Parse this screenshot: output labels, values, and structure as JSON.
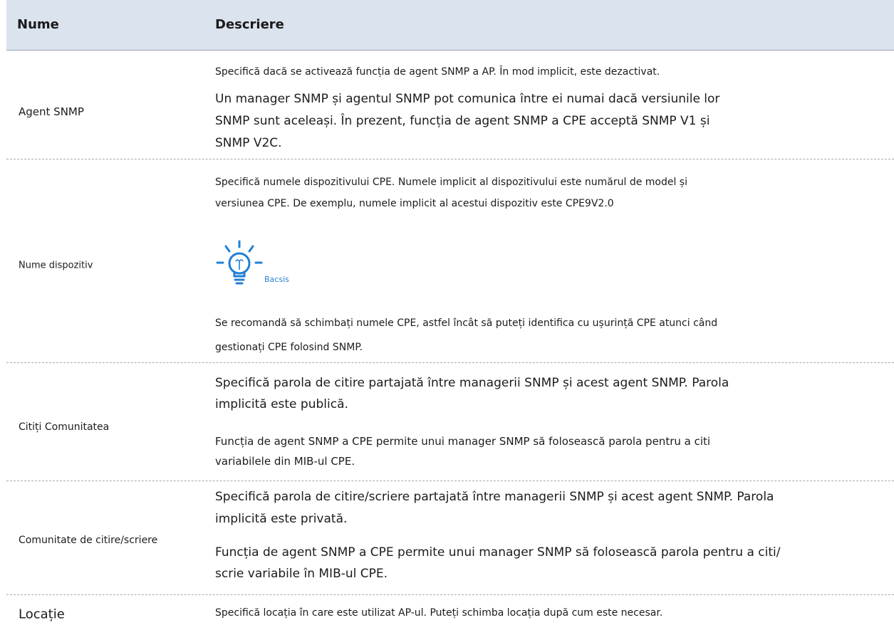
{
  "table": {
    "headers": {
      "name": "Nume",
      "description": "Descriere"
    },
    "rows": [
      {
        "name": "Agent SNMP",
        "lines": [
          "Specifică dacă se activează funcția de agent SNMP a AP. În mod implicit, este dezactivat.",
          "Un manager SNMP și agentul SNMP pot comunica între ei numai dacă versiunile lor",
          "SNMP sunt aceleași. În prezent, funcția de agent SNMP a CPE acceptă SNMP V1 și",
          "SNMP V2C."
        ]
      },
      {
        "name": "Nume dispozitiv",
        "lines": [
          "Specifică numele dispozitivului CPE. Numele implicit al dispozitivului este numărul de model și",
          "versiunea CPE. De exemplu, numele implicit al acestui dispozitiv este CPE9V2.0",
          "Se recomandă să schimbați numele CPE, astfel încât să puteți identifica cu ușurință CPE atunci când",
          "gestionați CPE folosind SNMP."
        ],
        "tip_label": "Bacsis",
        "tip_icon": "lightbulb-icon"
      },
      {
        "name": "Citiți Comunitatea",
        "lines": [
          "Specifică parola de citire partajată între managerii SNMP și acest agent SNMP. Parola",
          "implicită este publică.",
          "Funcția de agent SNMP a CPE permite unui manager SNMP să folosească parola pentru a citi",
          "variabilele din MIB-ul CPE."
        ]
      },
      {
        "name": "Comunitate de citire/scriere",
        "lines": [
          "Specifică parola de citire/scriere partajată între managerii SNMP și acest agent SNMP. Parola",
          "implicită este privată.",
          "Funcția de agent SNMP a CPE permite unui manager SNMP să folosească parola pentru a citi/",
          "scrie variabile în MIB-ul CPE."
        ]
      },
      {
        "name": "Locație",
        "lines": [
          "Specifică locația în care este utilizat AP-ul. Puteți schimba locația după cum este necesar."
        ]
      }
    ],
    "colors": {
      "header_bg": "#dbe3ee",
      "tip_text": "#2a7fd4",
      "icon": "#1f7fd6"
    }
  }
}
